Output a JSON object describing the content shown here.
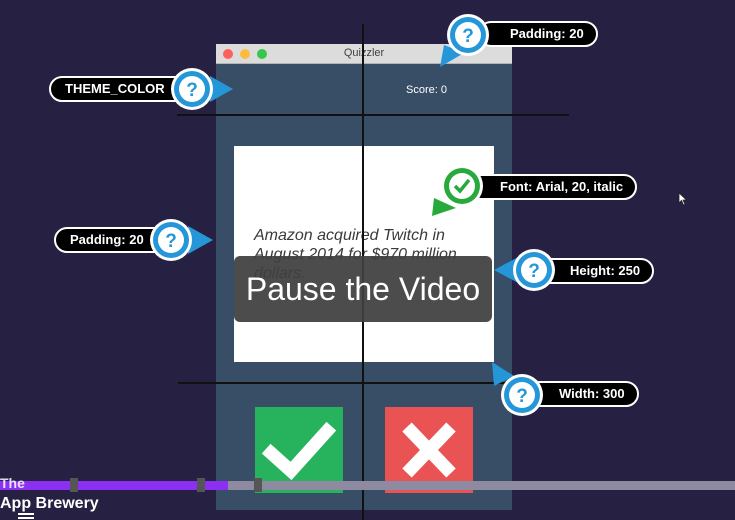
{
  "window": {
    "title": "Quizzler"
  },
  "score_label": "Score: 0",
  "question": {
    "text": "Amazon acquired Twitch in August 2014 for $970 million dollars."
  },
  "answers": {
    "true_icon": "checkmark-icon",
    "false_icon": "cross-icon"
  },
  "overlay": {
    "text": "Pause the Video"
  },
  "callouts": {
    "theme_color": "THEME_COLOR",
    "padding_top": "Padding: 20",
    "padding_left": "Padding: 20",
    "font": "Font: Arial, 20, italic",
    "height": "Height: 250",
    "width": "Width: 300"
  },
  "video": {
    "progress": 0.31
  },
  "brand": {
    "line1": "The",
    "line2": "App Brewery"
  },
  "colors": {
    "background": "#262143",
    "window": "#384d66",
    "true_button": "#27b35e",
    "false_button": "#ea5353",
    "callout_blue": "#2596d8",
    "callout_green": "#27a93b",
    "progress": "#8b2ff0"
  },
  "icons": {
    "question_badge": "question-mark-icon",
    "check_badge": "check-badge-icon",
    "menu": "menu-icon",
    "cursor": "mouse-cursor-icon"
  }
}
